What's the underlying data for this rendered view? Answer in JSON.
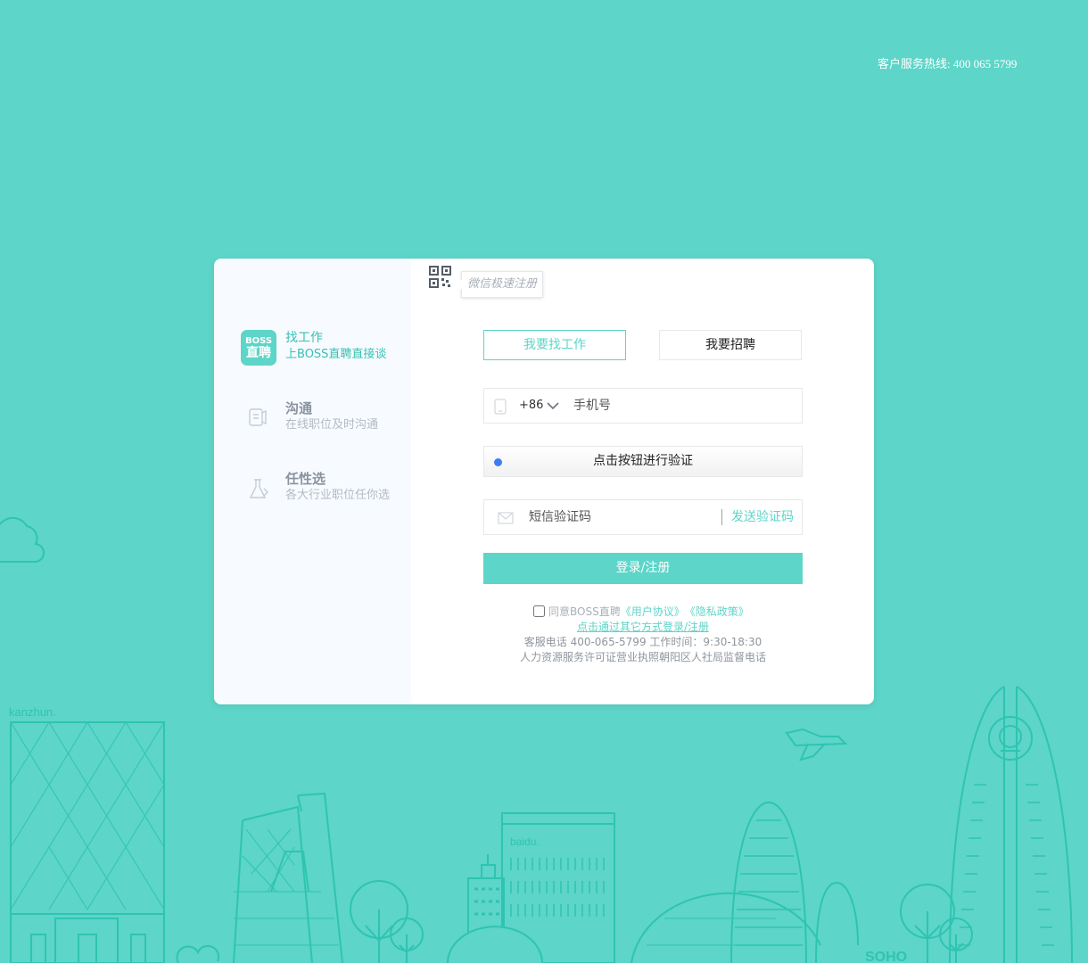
{
  "header": {
    "hotline": "客户服务热线: 400 065 5799"
  },
  "left_panel": {
    "features": [
      {
        "icon": "boss-logo-icon",
        "badge_top": "BOSS",
        "badge_bottom": "直聘",
        "title": "找工作",
        "subtitle": "上BOSS直聘直接谈"
      },
      {
        "icon": "chat-icon",
        "title": "沟通",
        "subtitle": "在线职位及时沟通"
      },
      {
        "icon": "flask-icon",
        "title": "任性选",
        "subtitle": "各大行业职位任你选"
      }
    ]
  },
  "qr": {
    "tooltip": "微信极速注册"
  },
  "tabs": {
    "geek": "我要找工作",
    "boss": "我要招聘"
  },
  "phone": {
    "country_code": "+86",
    "placeholder": "手机号"
  },
  "verify": {
    "label": "点击按钮进行验证"
  },
  "sms": {
    "placeholder": "短信验证码",
    "send_label": "发送验证码"
  },
  "submit": {
    "label": "登录/注册"
  },
  "agreement": {
    "prefix": "同意BOSS直聘",
    "user_agreement": "《用户协议》",
    "privacy": "《隐私政策》"
  },
  "other_login": "点击通过其它方式登录/注册",
  "footer_notes": {
    "service": "客服电话 400-065-5799 工作时间：9:30-18:30",
    "license": "人力资源服务许可证营业执照朝阳区人社局监督电话"
  },
  "illustration": {
    "label_kanzhun": "kanzhun.",
    "label_baidu": "baidu.",
    "label_soho": "SOHO"
  },
  "colors": {
    "brand": "#5dd5c8",
    "background": "#5dd5c8",
    "verify_dot": "#3e7cf4"
  }
}
